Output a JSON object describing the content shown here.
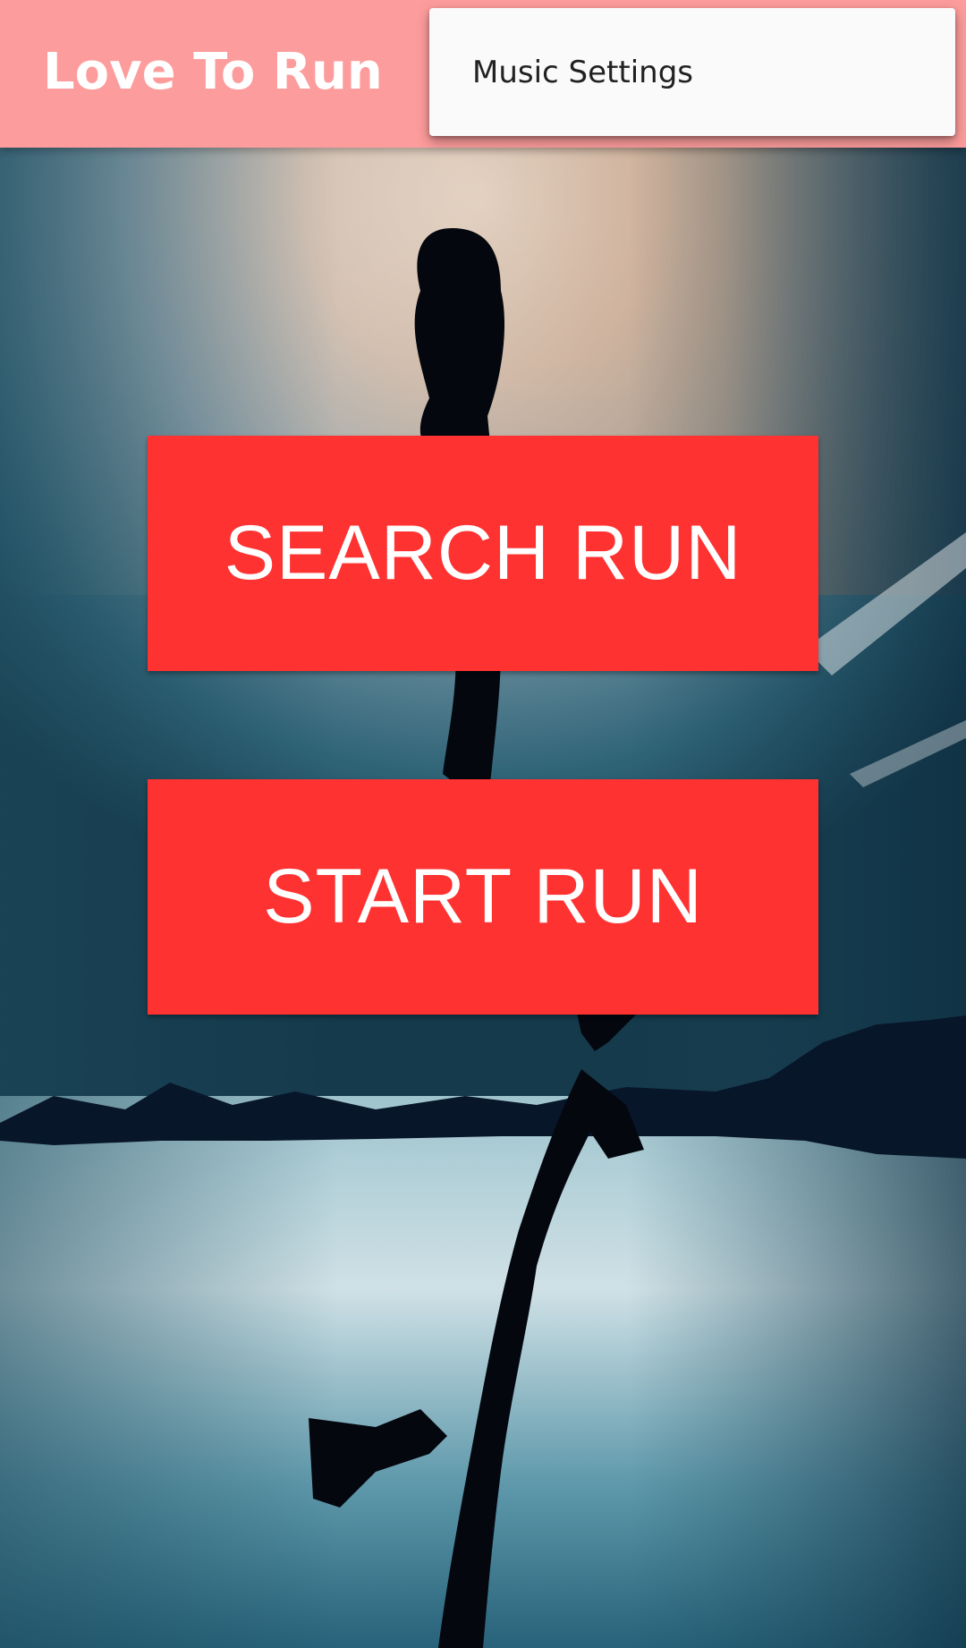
{
  "app_bar": {
    "title": "Love To Run"
  },
  "overflow_menu": {
    "items": [
      {
        "label": "Music Settings"
      }
    ]
  },
  "main": {
    "search_run_label": "SEARCH RUN",
    "start_run_label": "START RUN"
  },
  "colors": {
    "app_bar": "#fd9c9c",
    "button": "#ff3232",
    "menu_background": "#fafafa",
    "menu_text": "#212121"
  },
  "background": {
    "image": "silhouette of a woman running, reflected in water under a cloudy sky"
  }
}
